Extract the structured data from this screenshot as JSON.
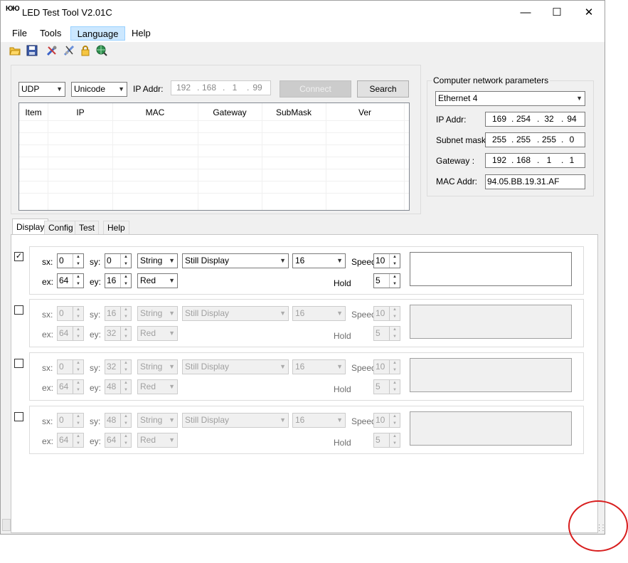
{
  "window": {
    "title": "LED Test Tool V2.01C",
    "app_icon_text": "ЮЮ",
    "minimize_glyph": "—",
    "maximize_glyph": "☐",
    "close_glyph": "✕"
  },
  "menu": [
    {
      "label": "File",
      "active": false
    },
    {
      "label": "Tools",
      "active": false
    },
    {
      "label": "Language",
      "active": true
    },
    {
      "label": "Help",
      "active": false
    }
  ],
  "toolbar_icons": [
    "open-folder-icon",
    "save-icon",
    "tools-icon",
    "network-icon",
    "lock-icon",
    "globe-search-icon"
  ],
  "connection": {
    "protocol": "UDP",
    "encoding": "Unicode",
    "ip_label": "IP Addr:",
    "ip": [
      "192",
      "168",
      "1",
      "99"
    ],
    "connect_label": "Connect",
    "search_label": "Search"
  },
  "device_list": {
    "columns": [
      "Item",
      "IP",
      "MAC",
      "Gateway",
      "SubMask",
      "Ver"
    ],
    "rows": []
  },
  "network_params": {
    "group_title": "Computer network parameters",
    "adapter": "Ethernet 4",
    "ip_label": "IP Addr:",
    "ip": [
      "169",
      "254",
      "32",
      "94"
    ],
    "subnet_label": "Subnet mask",
    "subnet": [
      "255",
      "255",
      "255",
      "0"
    ],
    "gateway_label": "Gateway :",
    "gateway": [
      "192",
      "168",
      "1",
      "1"
    ],
    "mac_label": "MAC Addr:",
    "mac": "94.05.BB.19.31.AF"
  },
  "tabs": [
    {
      "label": "Display",
      "active": true
    },
    {
      "label": "Config",
      "active": false
    },
    {
      "label": "Test",
      "active": false
    },
    {
      "label": "Help",
      "active": false
    }
  ],
  "labels": {
    "sx": "sx:",
    "sy": "sy:",
    "ex": "ex:",
    "ey": "ey:",
    "speed": "Speed",
    "hold": "Hold",
    "check_glyph": "✓",
    "spin_up": "▲",
    "spin_down": "▼",
    "dropdown": "▼"
  },
  "display_rows": [
    {
      "enabled": true,
      "checked": true,
      "sx": "0",
      "sy": "0",
      "ex": "64",
      "ey": "16",
      "type": "String",
      "mode": "Still Display",
      "font_size": "16",
      "color": "Red",
      "speed": "10",
      "hold": "5"
    },
    {
      "enabled": false,
      "checked": false,
      "sx": "0",
      "sy": "16",
      "ex": "64",
      "ey": "32",
      "type": "String",
      "mode": "Still Display",
      "font_size": "16",
      "color": "Red",
      "speed": "10",
      "hold": "5"
    },
    {
      "enabled": false,
      "checked": false,
      "sx": "0",
      "sy": "32",
      "ex": "64",
      "ey": "48",
      "type": "String",
      "mode": "Still Display",
      "font_size": "16",
      "color": "Red",
      "speed": "10",
      "hold": "5"
    },
    {
      "enabled": false,
      "checked": false,
      "sx": "0",
      "sy": "48",
      "ex": "64",
      "ey": "64",
      "type": "String",
      "mode": "Still Display",
      "font_size": "16",
      "color": "Red",
      "speed": "10",
      "hold": "5"
    }
  ],
  "colors": {
    "annotation": "#d81e1e",
    "menu_highlight": "#cce8ff"
  }
}
